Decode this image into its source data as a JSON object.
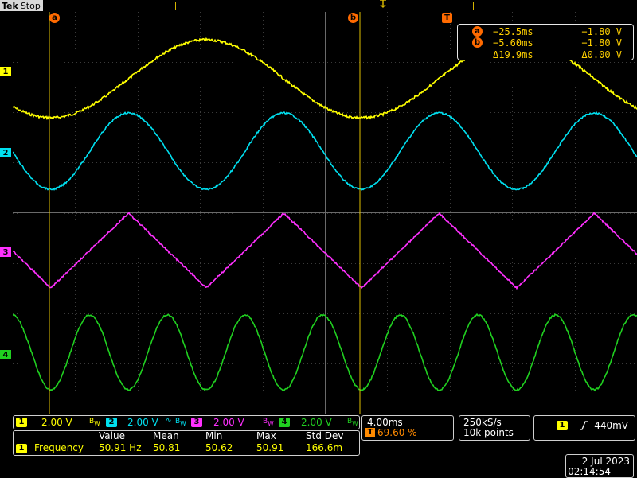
{
  "header": {
    "brand": "Tek",
    "status": "Stop"
  },
  "cursors": {
    "a": {
      "label": "a",
      "time": "−25.5ms",
      "voltage": "−1.80 V"
    },
    "b": {
      "label": "b",
      "time": "−5.60ms",
      "voltage": "−1.80 V"
    },
    "delta_time": "Δ19.9ms",
    "delta_voltage": "Δ0.00 V"
  },
  "trigger_marker": "T",
  "channels": [
    {
      "num": "1",
      "scale": "2.00 V",
      "color": "#ffff00"
    },
    {
      "num": "2",
      "scale": "2.00 V",
      "color": "#00e0f0"
    },
    {
      "num": "3",
      "scale": "2.00 V",
      "color": "#ff30ff"
    },
    {
      "num": "4",
      "scale": "2.00 V",
      "color": "#20d020"
    }
  ],
  "timebase": {
    "scale": "4.00ms",
    "trigger_position": "69.60 %",
    "sample_rate": "250kS/s",
    "record_length": "10k points"
  },
  "trigger": {
    "source": "1",
    "slope_icon": "rising-edge-icon",
    "level": "440mV"
  },
  "measurement": {
    "headers": [
      "Value",
      "Mean",
      "Min",
      "Max",
      "Std Dev"
    ],
    "channel": "1",
    "name": "Frequency",
    "values": [
      "50.91 Hz",
      "50.81",
      "50.62",
      "50.91",
      "166.6m"
    ]
  },
  "datetime": {
    "date": "2 Jul   2023",
    "time": "02:14:54"
  }
}
